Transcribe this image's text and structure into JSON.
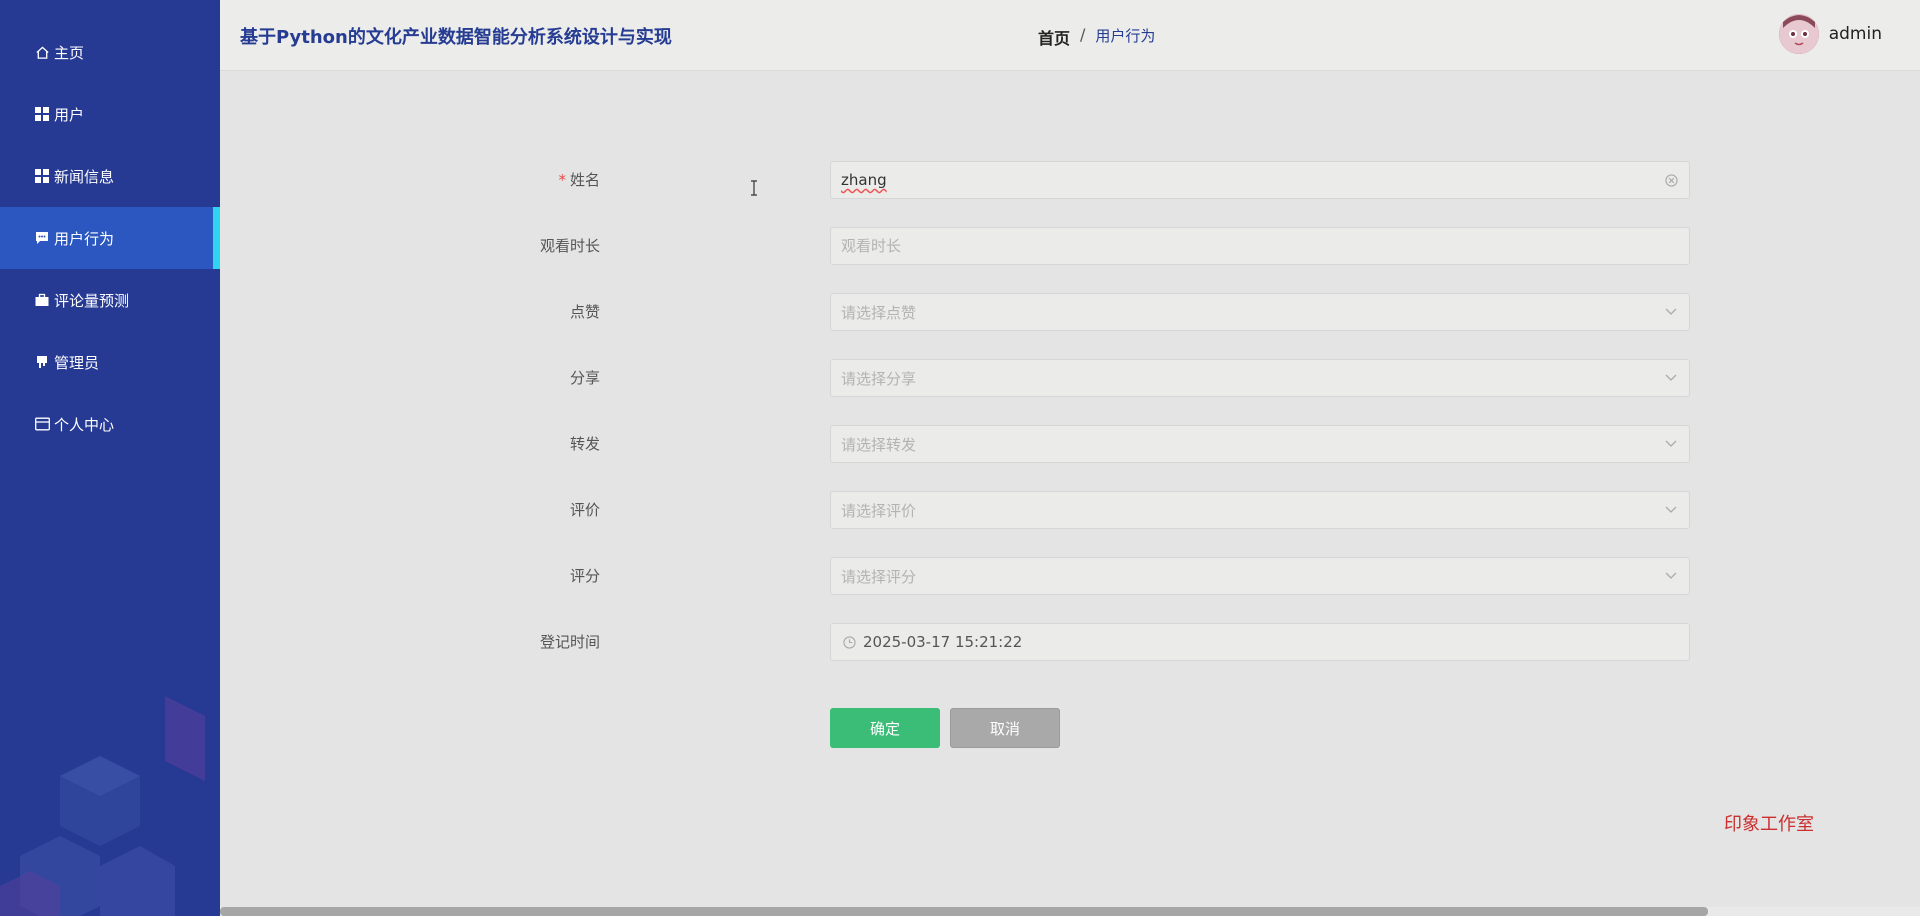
{
  "app": {
    "title": "基于Python的文化产业数据智能分析系统设计与实现"
  },
  "sidebar": {
    "items": [
      {
        "label": "主页",
        "icon": "home-icon",
        "active": false
      },
      {
        "label": "用户",
        "icon": "grid-icon",
        "active": false
      },
      {
        "label": "新闻信息",
        "icon": "grid-icon",
        "active": false
      },
      {
        "label": "用户行为",
        "icon": "chat-icon",
        "active": true
      },
      {
        "label": "评论量预测",
        "icon": "briefcase-icon",
        "active": false
      },
      {
        "label": "管理员",
        "icon": "flag-icon",
        "active": false
      },
      {
        "label": "个人中心",
        "icon": "card-icon",
        "active": false
      }
    ]
  },
  "header": {
    "breadcrumb": {
      "home": "首页",
      "separator": "/",
      "current": "用户行为"
    },
    "user": {
      "name": "admin"
    }
  },
  "form": {
    "name": {
      "label": "姓名",
      "required": true,
      "value": "zhang"
    },
    "watch_time": {
      "label": "观看时长",
      "placeholder": "观看时长"
    },
    "likes": {
      "label": "点赞",
      "placeholder": "请选择点赞"
    },
    "share": {
      "label": "分享",
      "placeholder": "请选择分享"
    },
    "forward": {
      "label": "转发",
      "placeholder": "请选择转发"
    },
    "review": {
      "label": "评价",
      "placeholder": "请选择评价"
    },
    "score": {
      "label": "评分",
      "placeholder": "请选择评分"
    },
    "register_time": {
      "label": "登记时间",
      "value": "2025-03-17 15:21:22"
    },
    "confirm_label": "确定",
    "cancel_label": "取消"
  },
  "watermark": "印象工作室",
  "colors": {
    "sidebar_bg": "#263a94",
    "sidebar_active": "#2c57c0",
    "active_indicator": "#2fd5f0",
    "confirm": "#3bbd78",
    "cancel": "#a9a9a9",
    "title": "#253c92",
    "watermark": "#cc2f2f"
  }
}
